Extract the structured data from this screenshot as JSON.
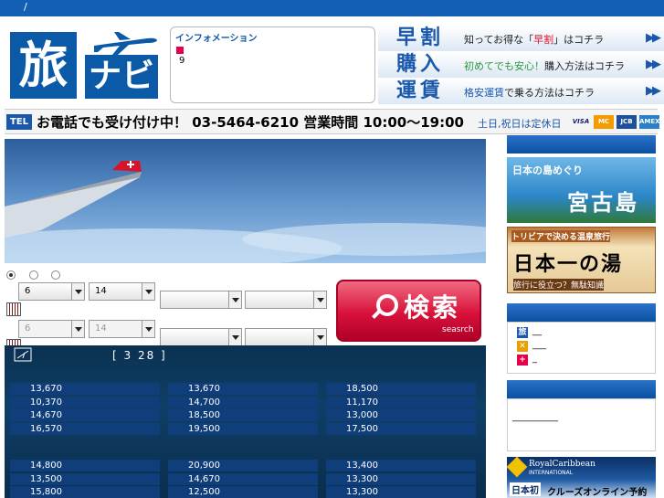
{
  "topbar": {
    "crumb": "/"
  },
  "logo": {
    "kanji": "旅",
    "katakana": "ナビ"
  },
  "info": {
    "title": "インフォメーション",
    "item": "9"
  },
  "promos": [
    {
      "big": "早割",
      "pre": "知ってお得な「",
      "hl": "早割",
      "post": "」はコチラ"
    },
    {
      "big": "購入",
      "pre": "",
      "hl": "初めてでも安心！",
      "post": "購入方法はコチラ"
    },
    {
      "big": "運賃",
      "pre": "",
      "hl": "格安運賃",
      "post": "で乗る方法はコチラ"
    }
  ],
  "tel": {
    "badge": "TEL",
    "message": "お電話でも受け付け中！ 03-5464-6210 営業時間 10:00〜19:00",
    "closed": "土日,祝日は定休日",
    "cards": [
      "VISA",
      "MC",
      "JCB",
      "AMEX"
    ]
  },
  "search": {
    "row1": {
      "day": "6",
      "num": "14"
    },
    "row2": {
      "day": "6",
      "num": "14"
    },
    "button_label": "検索",
    "button_sub": "seasrch"
  },
  "fares": {
    "header": "[ 3 28 ]",
    "group1": [
      [
        "13,670",
        "13,670",
        "18,500"
      ],
      [
        "10,370",
        "14,700",
        "11,170"
      ],
      [
        "14,670",
        "18,500",
        "13,000"
      ],
      [
        "16,570",
        "19,500",
        "17,500"
      ]
    ],
    "group2": [
      [
        "14,800",
        "20,900",
        "13,400"
      ],
      [
        "13,500",
        "14,670",
        "13,300"
      ],
      [
        "15,800",
        "12,500",
        "13,300"
      ]
    ]
  },
  "sidebar": {
    "banner1": {
      "top": "日本の島めぐり",
      "main": "宮古島"
    },
    "banner2": {
      "top": "トリビアで決める温泉旅行",
      "main": "日本一の湯",
      "sub": "旅行に役立つ？無駄知識"
    },
    "links": [
      {
        "icon": "旅",
        "label": "__",
        "color": "#1a58ab"
      },
      {
        "icon": "✕",
        "label": "___",
        "color": "#e8a000"
      },
      {
        "icon": "+",
        "label": "_",
        "color": "#e6004c"
      }
    ],
    "text_box": "__________",
    "banner3": {
      "brand": "RoyalCaribbean",
      "brand2": "INTERNATIONAL",
      "tag": "日本初",
      "text": "クルーズオンライン予約"
    }
  }
}
